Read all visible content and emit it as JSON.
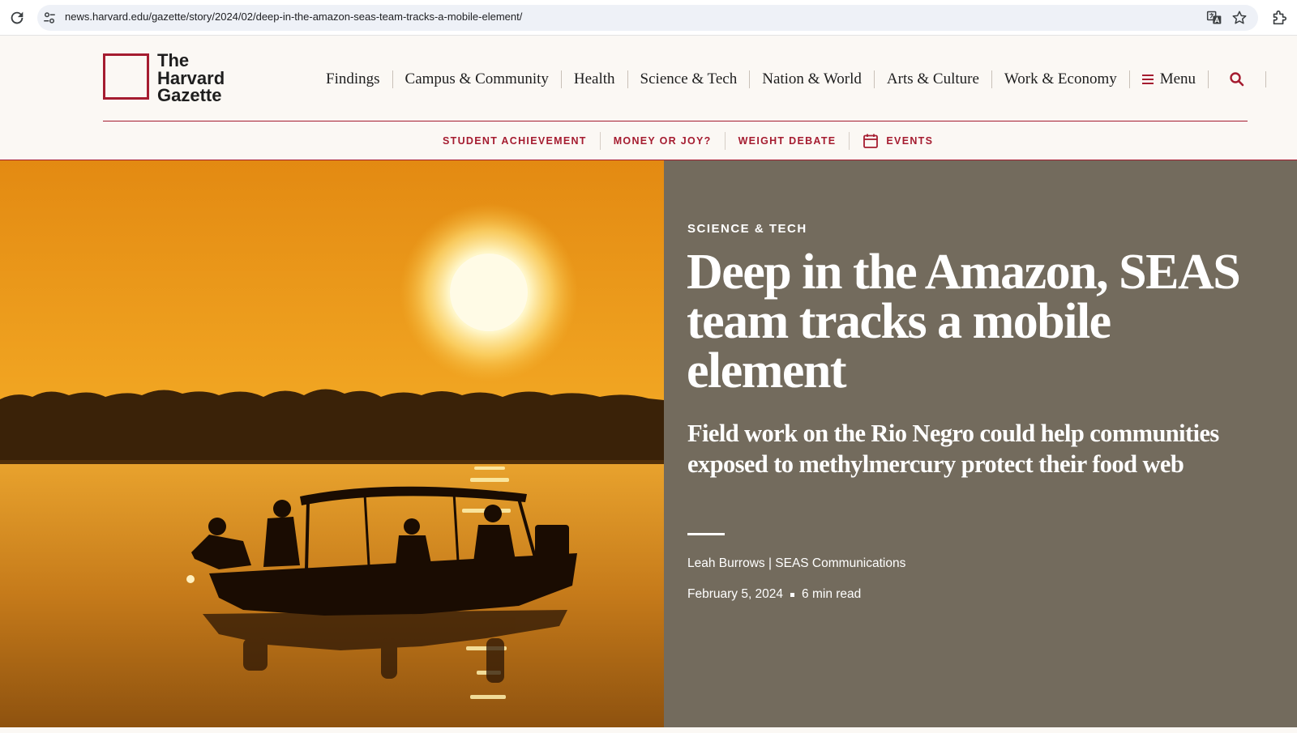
{
  "browser": {
    "url": "news.harvard.edu/gazette/story/2024/02/deep-in-the-amazon-seas-team-tracks-a-mobile-element/"
  },
  "site": {
    "logo_text": "The\nHarvard\nGazette",
    "brand_color": "#a51c30"
  },
  "nav": {
    "items": [
      {
        "label": "Findings"
      },
      {
        "label": "Campus & Community"
      },
      {
        "label": "Health"
      },
      {
        "label": "Science & Tech"
      },
      {
        "label": "Nation & World"
      },
      {
        "label": "Arts & Culture"
      },
      {
        "label": "Work & Economy"
      }
    ],
    "menu_label": "Menu"
  },
  "subnav": {
    "items": [
      {
        "label": "STUDENT ACHIEVEMENT"
      },
      {
        "label": "MONEY OR JOY?"
      },
      {
        "label": "WEIGHT DEBATE"
      }
    ],
    "events_label": "EVENTS"
  },
  "article": {
    "kicker": "SCIENCE & TECH",
    "headline": "Deep in the Amazon, SEAS team tracks a mobile element",
    "dek": "Field work on the Rio Negro could help communities exposed to methylmercury protect their food web",
    "byline": "Leah Burrows | SEAS Communications",
    "date": "February 5, 2024",
    "read_time": "6 min read",
    "panel_color": "#736b5d"
  }
}
